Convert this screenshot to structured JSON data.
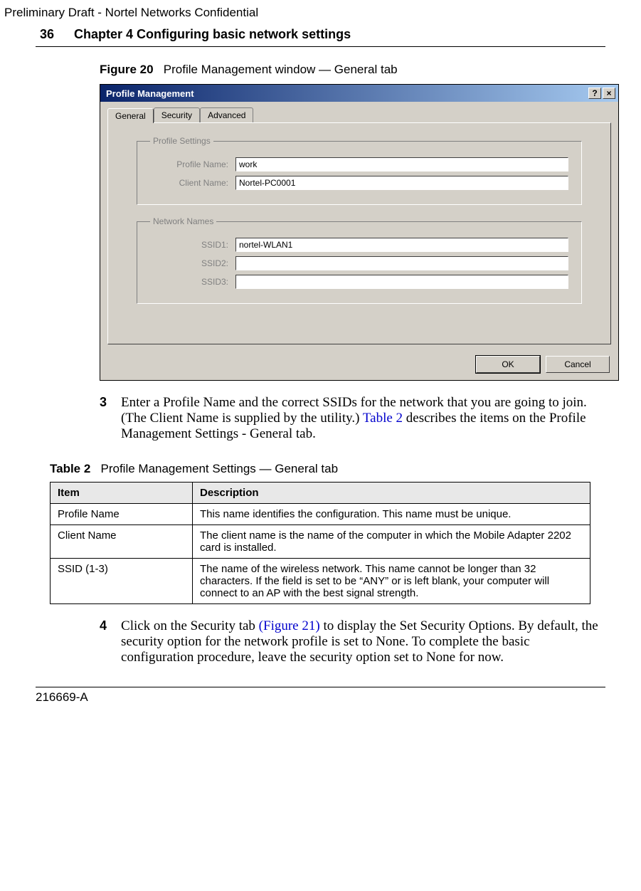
{
  "header": {
    "preliminary": "Preliminary Draft - Nortel Networks Confidential",
    "page_number": "36",
    "chapter_title": "Chapter 4 Configuring basic network settings"
  },
  "figure": {
    "label": "Figure 20",
    "caption": "Profile Management window — General tab"
  },
  "dialog": {
    "title": "Profile Management",
    "help_symbol": "?",
    "close_symbol": "×",
    "tabs": {
      "general": "General",
      "security": "Security",
      "advanced": "Advanced"
    },
    "profile_settings": {
      "legend": "Profile Settings",
      "profile_name_label": "Profile Name:",
      "profile_name_value": "work",
      "client_name_label": "Client Name:",
      "client_name_value": "Nortel-PC0001"
    },
    "network_names": {
      "legend": "Network Names",
      "ssid1_label": "SSID1:",
      "ssid1_value": "nortel-WLAN1",
      "ssid2_label": "SSID2:",
      "ssid2_value": "",
      "ssid3_label": "SSID3:",
      "ssid3_value": ""
    },
    "buttons": {
      "ok": "OK",
      "cancel": "Cancel"
    }
  },
  "step3": {
    "number": "3",
    "text_before_link": "Enter a Profile Name and the correct SSIDs for the network that you are going to join. (The Client Name is supplied by the utility.) ",
    "link_text": "Table 2",
    "text_after_link": " describes the items on the Profile Management Settings - General tab."
  },
  "table": {
    "label": "Table 2",
    "caption": "Profile Management Settings — General tab",
    "headers": {
      "item": "Item",
      "description": "Description"
    },
    "rows": [
      {
        "item": "Profile Name",
        "description": "This name identifies the configuration. This name must be unique."
      },
      {
        "item": "Client Name",
        "description": "The client name is the name of the computer in which the Mobile Adapter 2202 card is installed."
      },
      {
        "item": "SSID (1-3)",
        "description": "The name of the wireless network. This name cannot be longer than 32 characters. If the field is set to be “ANY” or is left blank, your computer will connect to an AP with the best signal strength."
      }
    ]
  },
  "step4": {
    "number": "4",
    "text_before_link": "Click on the Security tab ",
    "link_text": "(Figure 21)",
    "text_after_link": " to display the Set Security Options. By default, the security option for the network profile is set to None. To complete the basic configuration procedure, leave the security option set to None for now."
  },
  "footer": {
    "doc_id": "216669-A"
  }
}
